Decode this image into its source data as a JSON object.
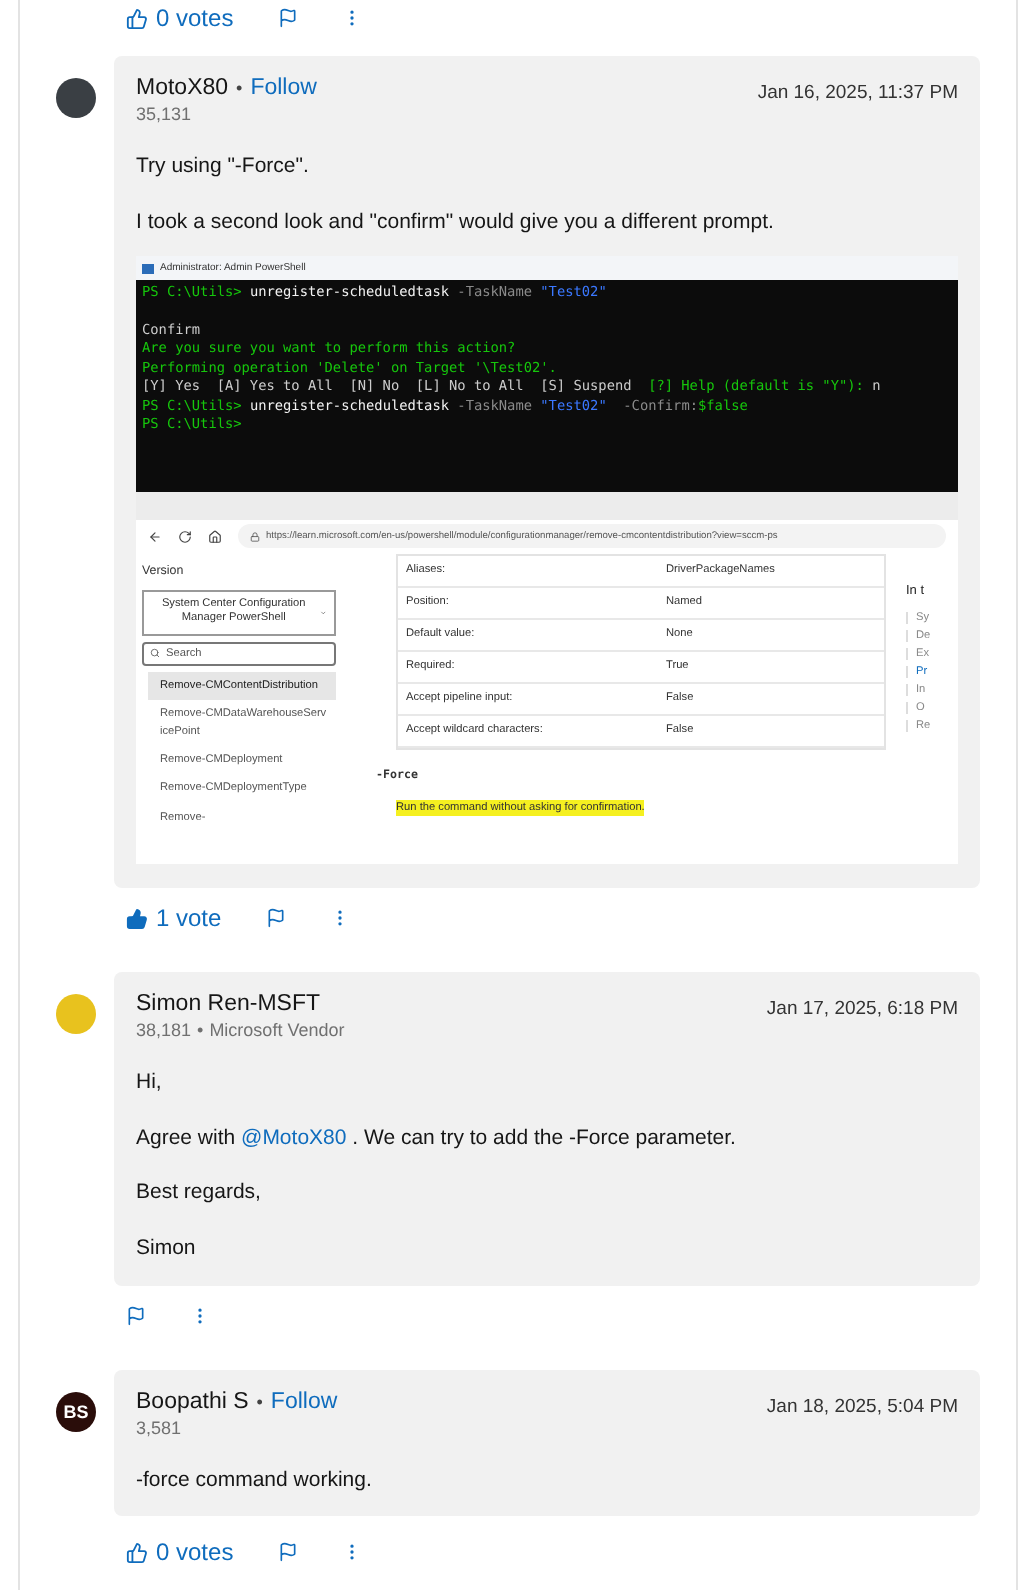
{
  "previous_post_actions": {
    "votes": "0 votes",
    "voted": false
  },
  "posts": [
    {
      "avatar": {
        "kind": "photo"
      },
      "author": "MotoX80",
      "separator": "•",
      "follow": "Follow",
      "reputation": "35,131",
      "date": "Jan 16, 2025, 11:37 PM",
      "paragraphs": [
        [
          {
            "kind": "text",
            "text": "Try using \"-Force\"."
          }
        ],
        [
          {
            "kind": "text",
            "text": "I took a second look and \"confirm\" would give you a different prompt."
          }
        ]
      ],
      "attachment": {
        "terminal": {
          "title": "Administrator: Admin PowerShell",
          "lines": [
            [
              {
                "kind": "prompt",
                "text": "PS C:\\Utils> "
              },
              {
                "kind": "command",
                "text": "unregister-scheduledtask"
              },
              {
                "kind": "param",
                "text": " -TaskName "
              },
              {
                "kind": "string",
                "text": "\"Test02\""
              }
            ],
            [
              {
                "kind": "plain",
                "text": "Confirm",
                "spaced": true
              }
            ],
            [
              {
                "kind": "prompt",
                "text": "Are you sure you want to perform this action?"
              }
            ],
            [
              {
                "kind": "prompt",
                "text": "Performing operation 'Delete' on Target '\\Test02'."
              }
            ],
            [
              {
                "kind": "plain",
                "text": "[Y] Yes  [A] Yes to All  [N] No  [L] No to All  [S] Suspend  "
              },
              {
                "kind": "prompt",
                "text": "[?] Help (default is \"Y\"): "
              },
              {
                "kind": "plain",
                "text": "n"
              }
            ],
            [
              {
                "kind": "prompt",
                "text": "PS C:\\Utils> "
              },
              {
                "kind": "command",
                "text": "unregister-scheduledtask"
              },
              {
                "kind": "param",
                "text": " -TaskName "
              },
              {
                "kind": "string",
                "text": "\"Test02\""
              },
              {
                "kind": "param",
                "text": "  -Confirm:"
              },
              {
                "kind": "prompt",
                "text": "$false"
              }
            ],
            [
              {
                "kind": "prompt",
                "text": "PS C:\\Utils>"
              }
            ]
          ]
        },
        "browser": {
          "url": "https://learn.microsoft.com/en-us/powershell/module/configurationmanager/remove-cmcontentdistribution?view=sccm-ps",
          "version_label": "Version",
          "version_value": "System Center Configuration Manager PowerShell",
          "search_placeholder": "Search",
          "nav_items": [
            {
              "label": "Remove-CMContentDistribution",
              "selected": true
            },
            {
              "label": "Remove-CMDataWarehouseServicePoint",
              "selected": false
            },
            {
              "label": "Remove-CMDeployment",
              "selected": false
            },
            {
              "label": "Remove-CMDeploymentType",
              "selected": false
            },
            {
              "label": "Remove-",
              "selected": false
            }
          ],
          "table": [
            [
              "Aliases:",
              "DriverPackageNames"
            ],
            [
              "Position:",
              "Named"
            ],
            [
              "Default value:",
              "None"
            ],
            [
              "Required:",
              "True"
            ],
            [
              "Accept pipeline input:",
              "False"
            ],
            [
              "Accept wildcard characters:",
              "False"
            ]
          ],
          "param_name": "-Force",
          "param_description": "Run the command without asking for confirmation.",
          "toc_title": "In t",
          "toc_items": [
            {
              "label": "Sy",
              "selected": false
            },
            {
              "label": "De",
              "selected": false
            },
            {
              "label": "Ex",
              "selected": false
            },
            {
              "label": "Pr",
              "selected": true
            },
            {
              "label": "In",
              "selected": false
            },
            {
              "label": "O",
              "selected": false
            },
            {
              "label": "Re",
              "selected": false
            }
          ]
        }
      },
      "actions": {
        "votes": "1 vote",
        "voted": true
      }
    },
    {
      "avatar": {
        "kind": "flower"
      },
      "author": "Simon Ren-MSFT",
      "reputation": "38,181",
      "separator": "•",
      "badge": "Microsoft Vendor",
      "date": "Jan 17, 2025, 6:18 PM",
      "paragraphs": [
        [
          {
            "kind": "text",
            "text": "Hi,"
          }
        ],
        [
          {
            "kind": "text",
            "text": "Agree with "
          },
          {
            "kind": "mention",
            "text": "@MotoX80"
          },
          {
            "kind": "text",
            "text": " . We can try to add the -Force parameter."
          }
        ],
        [
          {
            "kind": "text",
            "text": "Best regards,"
          }
        ],
        [
          {
            "kind": "text",
            "text": "Simon"
          }
        ]
      ]
    },
    {
      "avatar": {
        "kind": "initials",
        "text": "BS"
      },
      "author": "Boopathi S",
      "separator": "•",
      "follow": "Follow",
      "reputation": "3,581",
      "date": "Jan 18, 2025, 5:04 PM",
      "paragraphs": [
        [
          {
            "kind": "text",
            "text": "-force command working."
          }
        ]
      ],
      "actions": {
        "votes": "0 votes",
        "voted": false
      }
    }
  ]
}
